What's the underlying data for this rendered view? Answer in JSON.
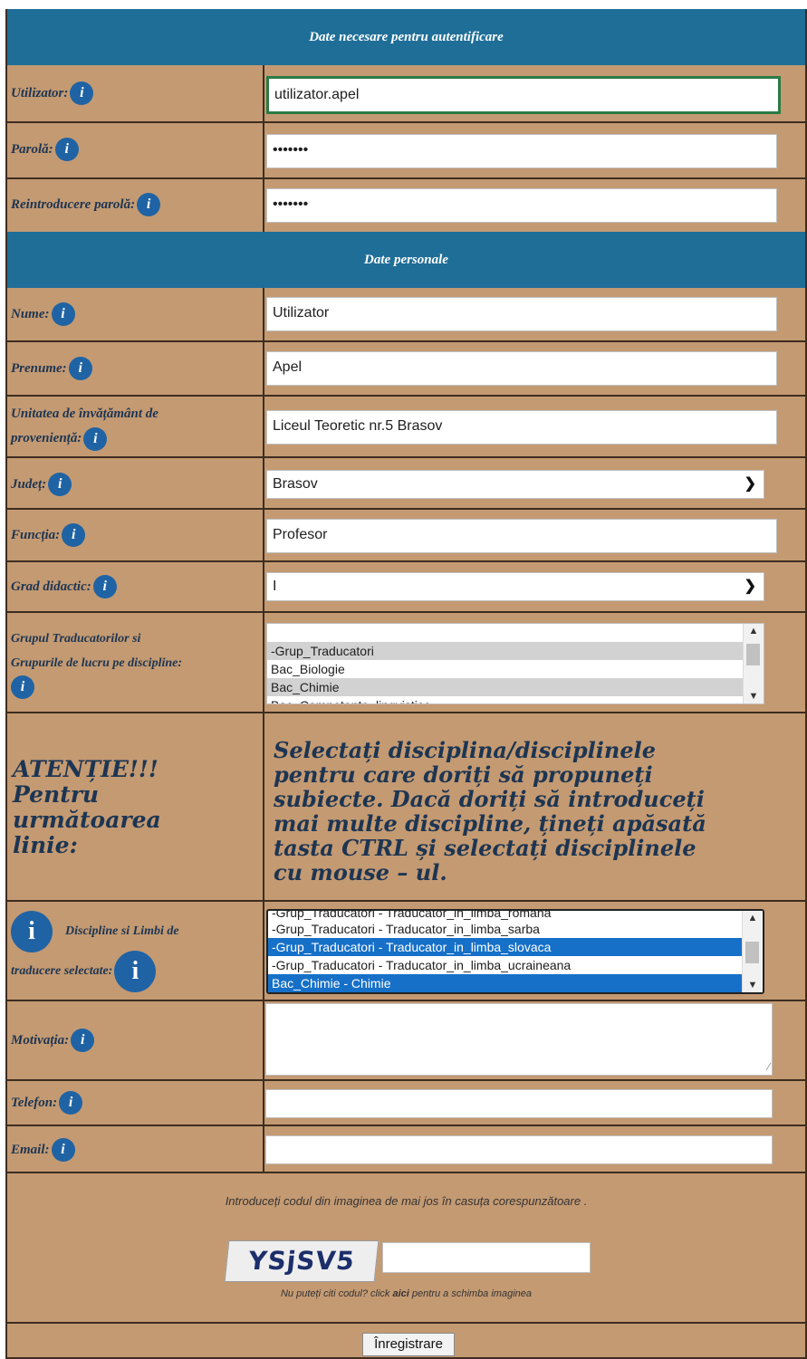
{
  "sections": {
    "auth_title": "Date necesare pentru autentificare",
    "personal_title": "Date personale"
  },
  "info_icon": "i",
  "fields": {
    "username": {
      "label": "Utilizator:",
      "value": "utilizator.apel"
    },
    "password": {
      "label": "Parolă:",
      "value": "•••••••"
    },
    "password_confirm": {
      "label": "Reintroducere parolă:",
      "value": "•••••••"
    },
    "last_name": {
      "label": "Nume:",
      "value": "Utilizator"
    },
    "first_name": {
      "label": "Prenume:",
      "value": "Apel"
    },
    "school": {
      "label_line1": "Unitatea de învățământ de",
      "label_line2": "proveniență:",
      "value": "Liceul Teoretic nr.5 Brasov"
    },
    "county": {
      "label": "Județ:",
      "value": "Brasov"
    },
    "function": {
      "label": "Funcția:",
      "value": "Profesor"
    },
    "grade": {
      "label": "Grad didactic:",
      "value": "I"
    },
    "groups": {
      "label_line1": "Grupul Traducatorilor si",
      "label_line2": "Grupurile de lucru pe discipline:",
      "options": [
        "-Grup_Traducatori",
        "Bac_Biologie",
        "Bac_Chimie",
        "Bac_Competente_lingvistice"
      ]
    },
    "selected_disciplines": {
      "label_line1": "Discipline si Limbi de",
      "label_line2": "traducere selectate:",
      "options": [
        "-Grup_Traducatori - Traducator_in_limba_romana",
        "-Grup_Traducatori - Traducator_in_limba_sarba",
        "-Grup_Traducatori - Traducator_in_limba_slovaca",
        "-Grup_Traducatori - Traducator_in_limba_ucraineana",
        "Bac_Chimie - Chimie"
      ]
    },
    "motivation": {
      "label": "Motivația:",
      "value": ""
    },
    "phone": {
      "label": "Telefon:",
      "value": ""
    },
    "email": {
      "label": "Email:",
      "value": ""
    }
  },
  "warning": {
    "left_line1": "ATENȚIE!!!",
    "left_line2": "Pentru",
    "left_line3": "următoarea",
    "left_line4": "linie:",
    "right_line1": "Selectați disciplina/disciplinele",
    "right_line2": "pentru care doriți să propuneți",
    "right_line3": "subiecte. Dacă doriți să introduceți",
    "right_line4": "mai multe discipline, țineți apăsată",
    "right_line5": "tasta CTRL și selectați disciplinele",
    "right_line6": "cu mouse – ul."
  },
  "captcha": {
    "instruction": "Introduceți codul din imaginea de mai jos în casuța corespunzătoare .",
    "code": "YSjSV5",
    "input_value": "",
    "refresh_prefix": "Nu puteți citi codul? click",
    "refresh_link": "aici",
    "refresh_suffix": "pentru a schimba imaginea"
  },
  "submit_label": "Înregistrare"
}
